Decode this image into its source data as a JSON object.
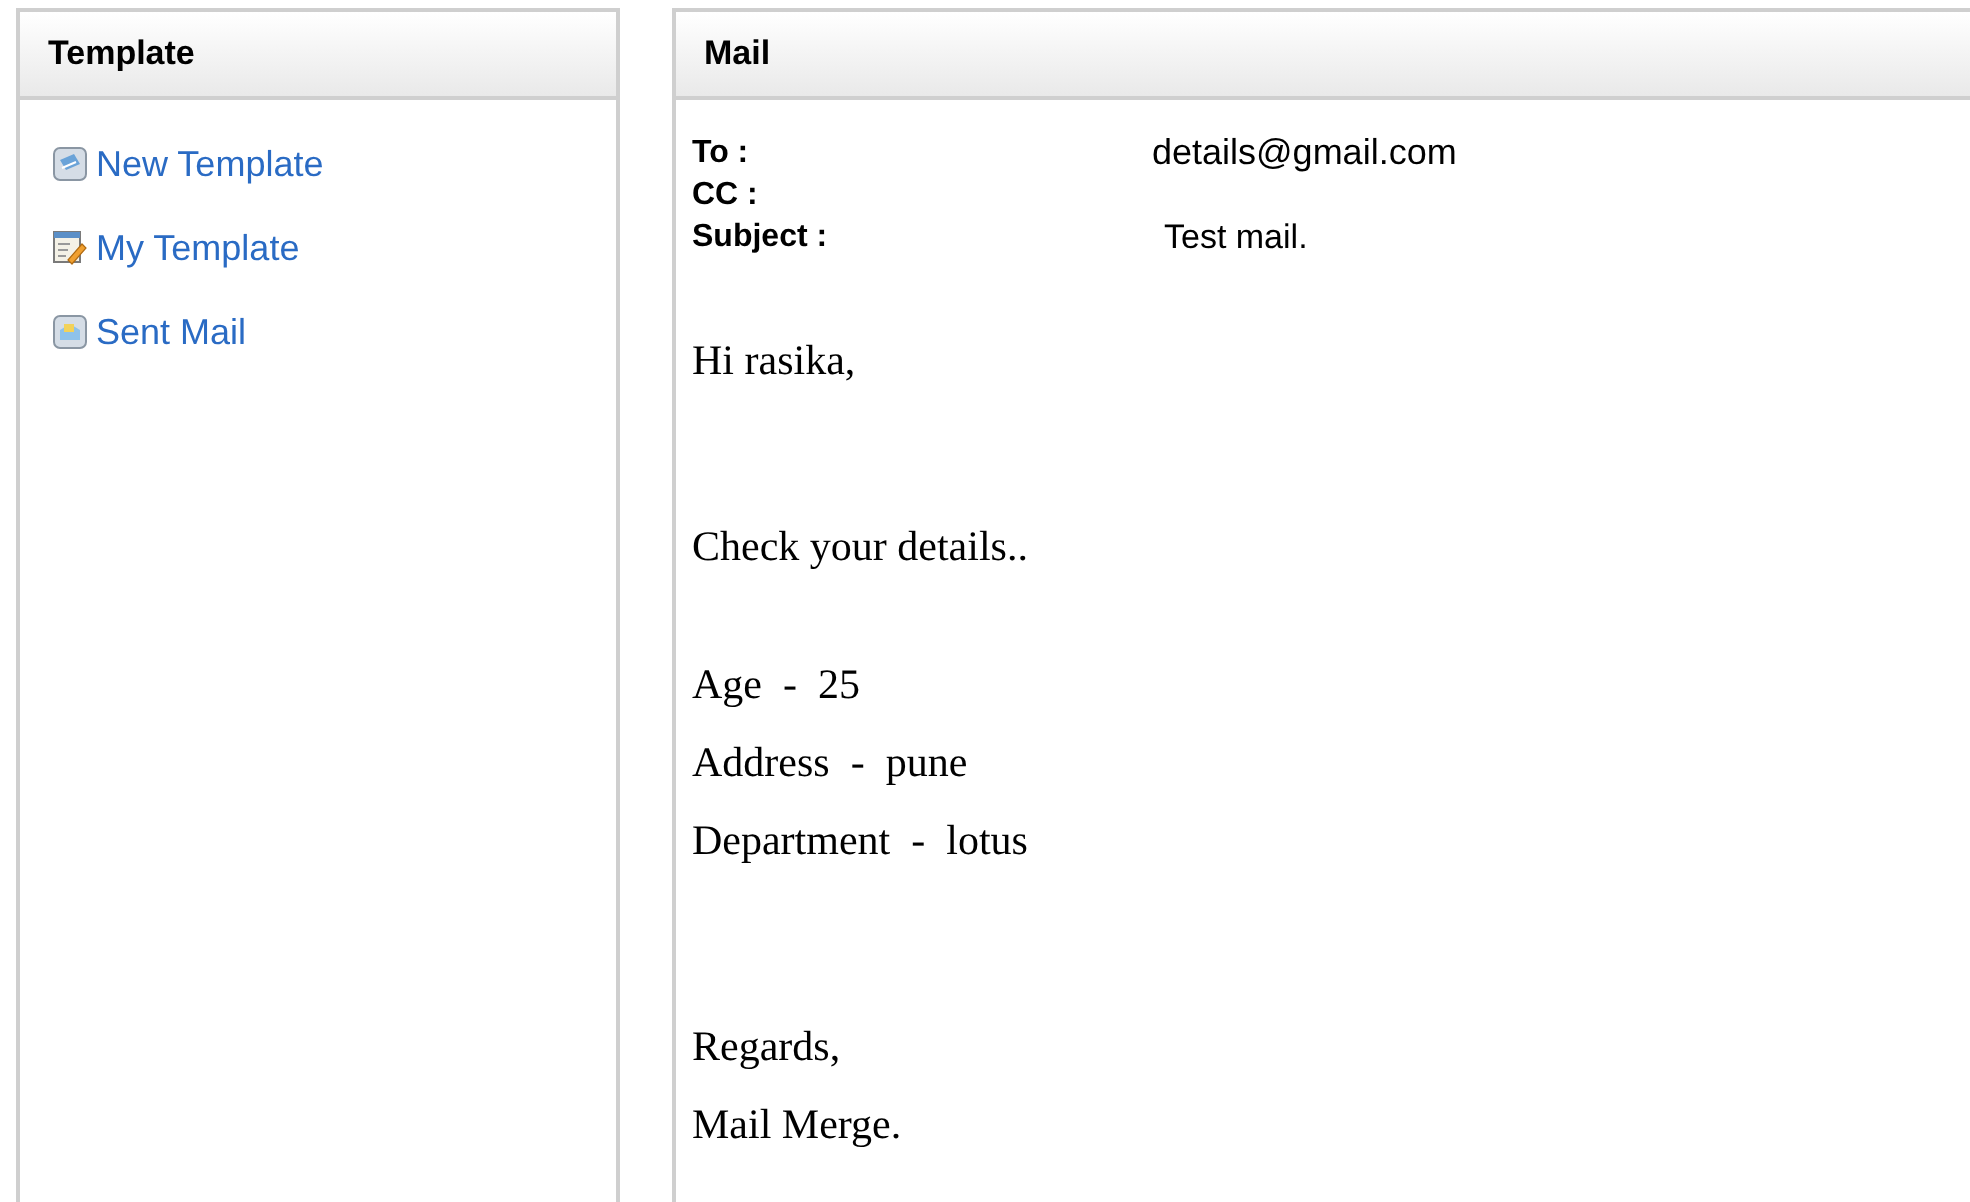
{
  "template_panel": {
    "title": "Template",
    "items": [
      {
        "label": "New Template",
        "kind": "new"
      },
      {
        "label": "My Template",
        "kind": "edit"
      },
      {
        "label": "Sent Mail",
        "kind": "sent"
      }
    ]
  },
  "mail_panel": {
    "title": "Mail",
    "fields": [
      {
        "label": "To :",
        "value": "details@gmail.com"
      },
      {
        "label": "CC :"
      },
      {
        "label": "Subject :",
        "value": "Test mail."
      }
    ],
    "body": [
      [
        "Hi rasika,"
      ],
      [
        "Check your details.."
      ],
      [
        "Age  -  25",
        "Address  -  pune",
        "Department  -  lotus"
      ],
      [
        "Regards,",
        "Mail Merge."
      ]
    ]
  }
}
